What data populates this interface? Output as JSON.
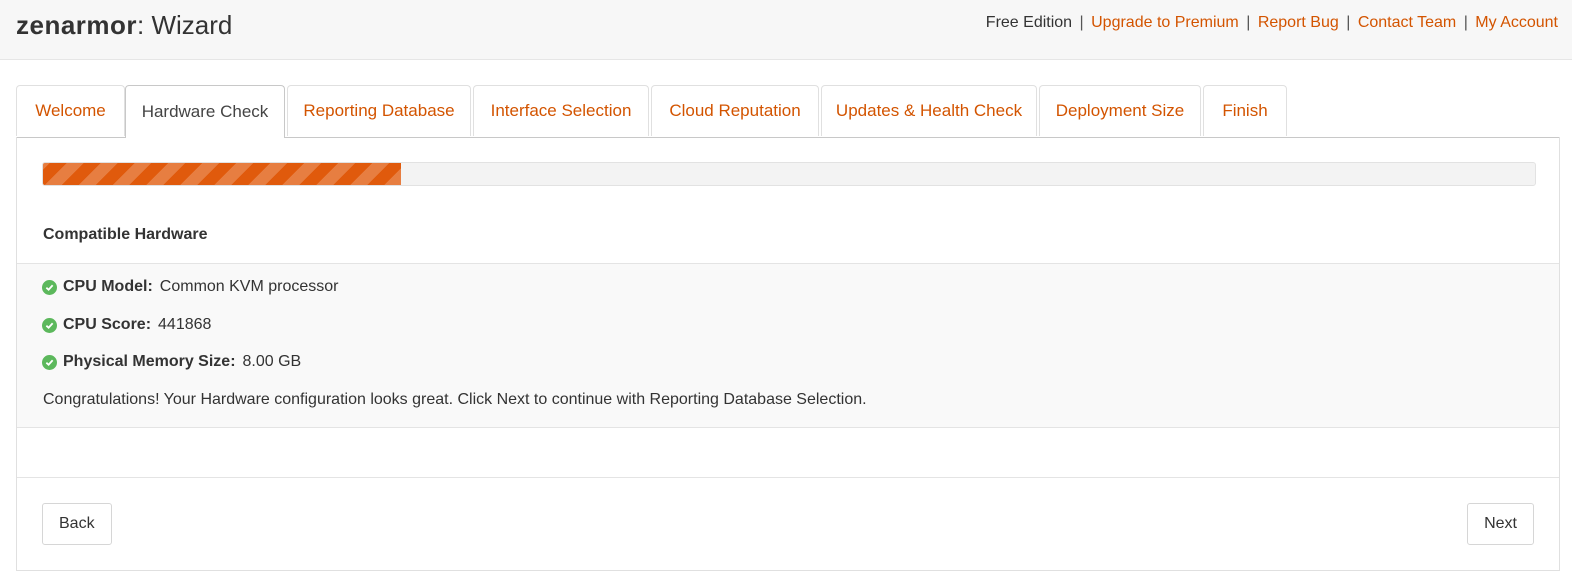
{
  "header": {
    "logo": "zenarmor",
    "title_suffix": ": Wizard",
    "edition": "Free Edition",
    "links": [
      "Upgrade to Premium",
      "Report Bug",
      "Contact Team",
      "My Account"
    ],
    "separator": "|"
  },
  "tabs": [
    {
      "label": "Welcome",
      "active": false
    },
    {
      "label": "Hardware Check",
      "active": true
    },
    {
      "label": "Reporting Database",
      "active": false
    },
    {
      "label": "Interface Selection",
      "active": false
    },
    {
      "label": "Cloud Reputation",
      "active": false
    },
    {
      "label": "Updates & Health Check",
      "active": false
    },
    {
      "label": "Deployment Size",
      "active": false
    },
    {
      "label": "Finish",
      "active": false
    }
  ],
  "progress": {
    "percent": 24
  },
  "hardware": {
    "section_title": "Compatible Hardware",
    "items": [
      {
        "label": "CPU Model:",
        "value": "Common KVM processor",
        "icon": "check-circle-icon"
      },
      {
        "label": "CPU Score:",
        "value": "441868",
        "icon": "check-circle-icon"
      },
      {
        "label": "Physical Memory Size:",
        "value": "8.00 GB",
        "icon": "check-circle-icon"
      }
    ],
    "message": "Congratulations! Your Hardware configuration looks great. Click Next to continue with Reporting Database Selection."
  },
  "buttons": {
    "back": "Back",
    "next": "Next"
  },
  "colors": {
    "accent": "#d35400",
    "progress": "#e05a0c",
    "success": "#5cb85c"
  }
}
